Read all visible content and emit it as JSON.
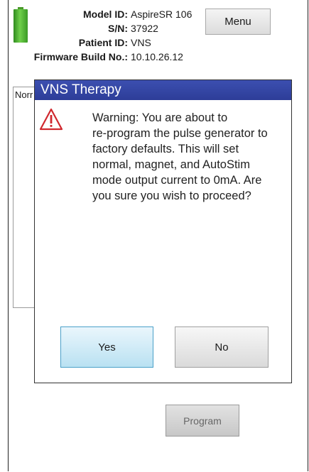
{
  "header": {
    "model_label": "Model ID:",
    "model_value": "AspireSR 106",
    "serial_label": "S/N:",
    "serial_value": "37922",
    "patient_label": "Patient ID:",
    "patient_value": "VNS",
    "firmware_label": "Firmware Build No.:",
    "firmware_value": "10.10.26.12",
    "menu_label": "Menu",
    "battery_icon": "battery-full-icon",
    "battery_level_percent": 100,
    "battery_color": "#4caf2a"
  },
  "background": {
    "panel_label": "Norr"
  },
  "dialog": {
    "title": "VNS Therapy",
    "title_bar_color": "#3346a6",
    "icon": "warning-triangle-icon",
    "message": "Warning: You are about to\nre-program the pulse generator to\nfactory defaults. This will set\nnormal, magnet, and AutoStim\nmode output current to 0mA. Are\nyou sure you wish to proceed?",
    "yes_label": "Yes",
    "no_label": "No"
  },
  "footer": {
    "program_label": "Program"
  }
}
